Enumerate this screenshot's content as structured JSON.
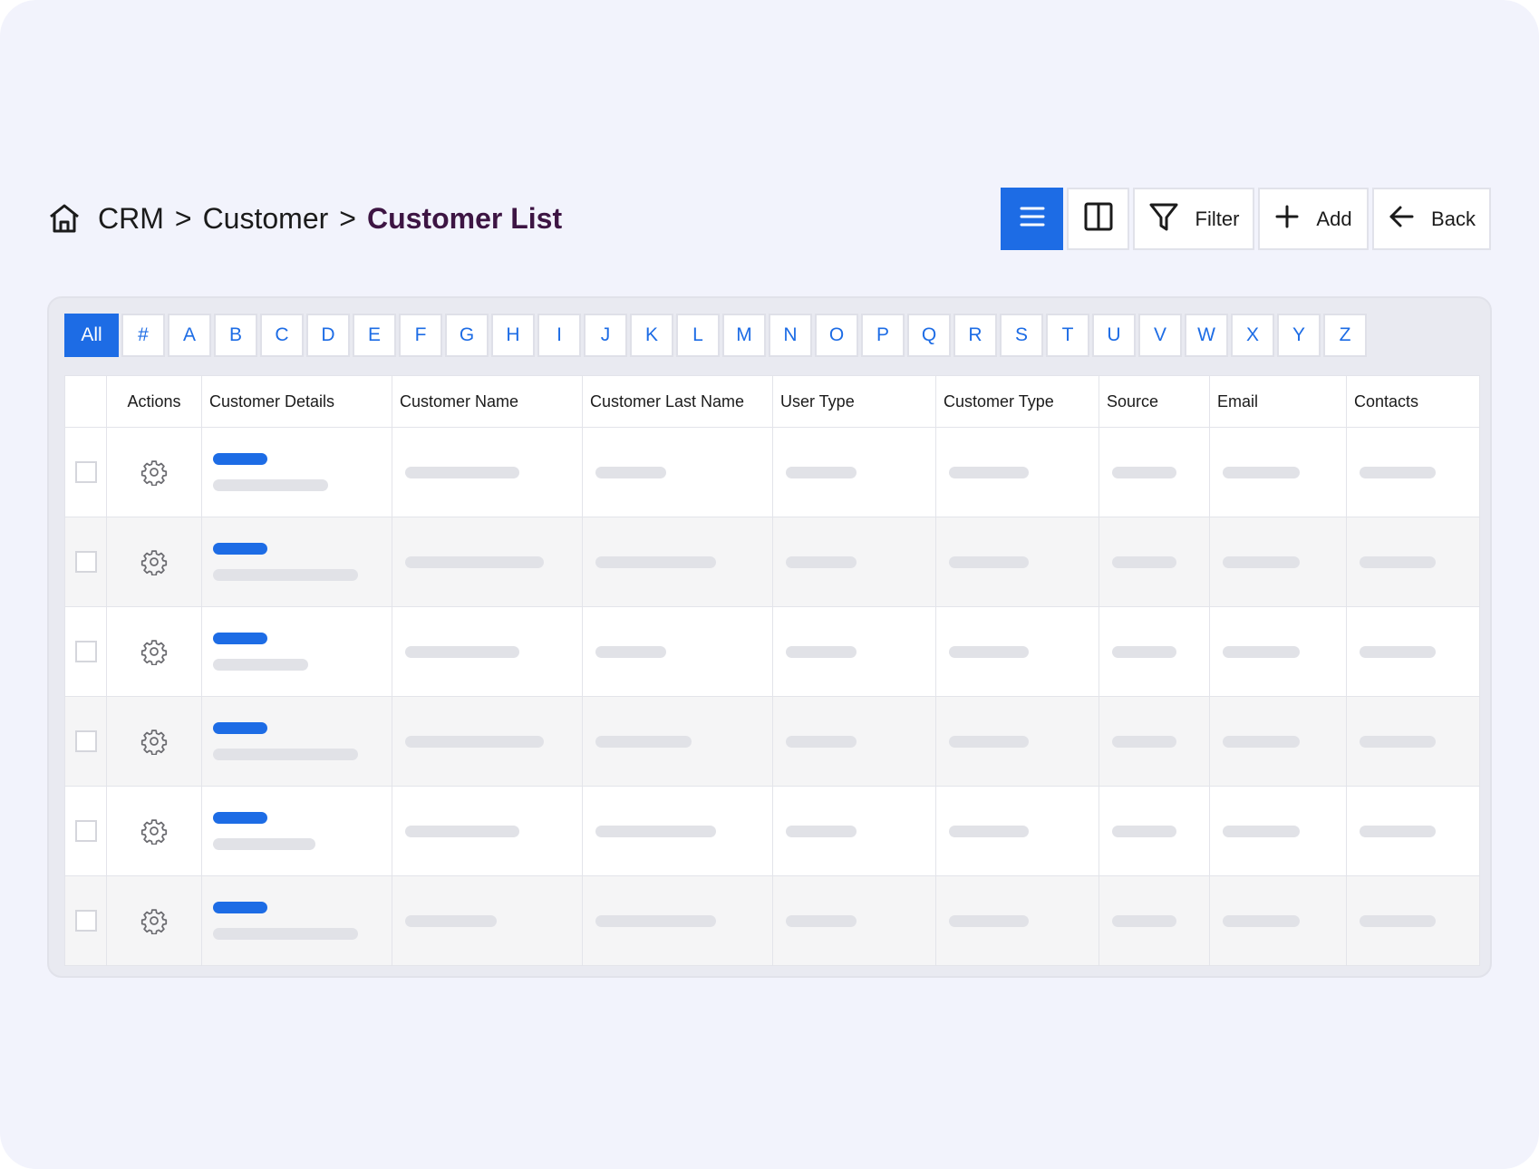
{
  "breadcrumb": {
    "items": [
      "CRM",
      "Customer"
    ],
    "current": "Customer List",
    "separator": ">"
  },
  "toolbar": {
    "filter_label": "Filter",
    "add_label": "Add",
    "back_label": "Back"
  },
  "alphabet": {
    "all_label": "All",
    "letters": [
      "#",
      "A",
      "B",
      "C",
      "D",
      "E",
      "F",
      "G",
      "H",
      "I",
      "J",
      "K",
      "L",
      "M",
      "N",
      "O",
      "P",
      "Q",
      "R",
      "S",
      "T",
      "U",
      "V",
      "W",
      "X",
      "Y",
      "Z"
    ]
  },
  "table": {
    "columns": [
      "",
      "Actions",
      "Customer Details",
      "Customer Name",
      "Customer Last Name",
      "User Type",
      "Customer Type",
      "Source",
      "Email",
      "Contacts"
    ]
  },
  "colors": {
    "accent": "#1d6ce5",
    "breadcrumb_current": "#3d1543",
    "placeholder": "#e1e2e7",
    "background": "#f2f3fc"
  }
}
